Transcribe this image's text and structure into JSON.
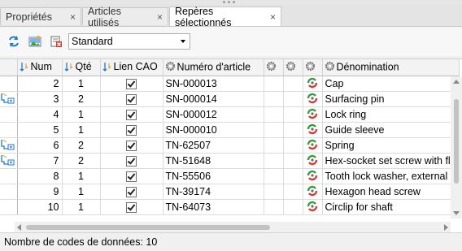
{
  "tabs": [
    {
      "label": "Propriétés",
      "close": "×"
    },
    {
      "label": "Articles utilisés",
      "close": "×"
    },
    {
      "label": "Repères sélectionnés",
      "close": "×"
    }
  ],
  "toolbar": {
    "icons": [
      "refresh-icon",
      "picture-icon",
      "delete-list-icon"
    ],
    "view_select": "Standard"
  },
  "table": {
    "columns": [
      "Num",
      "Qté",
      "Lien CAO",
      "Numéro d'article",
      "",
      "",
      "",
      "Dénomination"
    ],
    "rows": [
      {
        "indicator": false,
        "num": "2",
        "qte": "1",
        "cad": true,
        "article": "SN-000013",
        "name": "Cap"
      },
      {
        "indicator": true,
        "num": "3",
        "qte": "2",
        "cad": true,
        "article": "SN-000014",
        "name": "Surfacing pin"
      },
      {
        "indicator": false,
        "num": "4",
        "qte": "1",
        "cad": true,
        "article": "SN-000012",
        "name": "Lock ring"
      },
      {
        "indicator": false,
        "num": "5",
        "qte": "1",
        "cad": true,
        "article": "SN-000010",
        "name": "Guide sleeve"
      },
      {
        "indicator": true,
        "num": "6",
        "qte": "2",
        "cad": true,
        "article": "TN-62507",
        "name": "Spring"
      },
      {
        "indicator": true,
        "num": "7",
        "qte": "2",
        "cad": true,
        "article": "TN-51648",
        "name": "Hex-socket set screw with fla"
      },
      {
        "indicator": false,
        "num": "8",
        "qte": "1",
        "cad": true,
        "article": "TN-55506",
        "name": "Tooth lock washer, external t"
      },
      {
        "indicator": false,
        "num": "9",
        "qte": "1",
        "cad": true,
        "article": "TN-39174",
        "name": "Hexagon head screw"
      },
      {
        "indicator": false,
        "num": "10",
        "qte": "1",
        "cad": true,
        "article": "TN-64073",
        "name": "Circlip for shaft"
      }
    ]
  },
  "status": {
    "text": "Nombre de codes de données: 10"
  },
  "colors": {
    "accent": "#1e7ad6",
    "status_green": "#3a9a3a",
    "status_red": "#d43a2f"
  }
}
